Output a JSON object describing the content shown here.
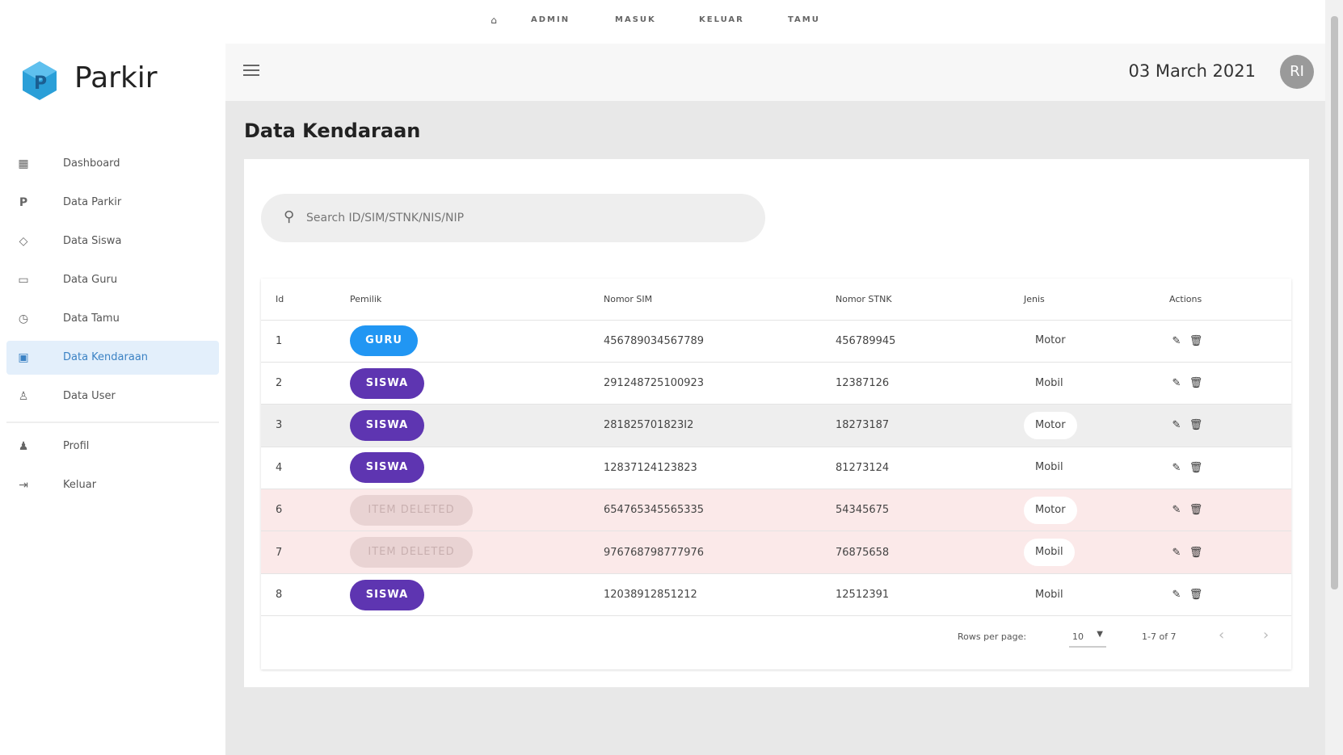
{
  "topnav": {
    "home_icon": "home-icon",
    "links": [
      "ADMIN",
      "MASUK",
      "KELUAR",
      "TAMU"
    ]
  },
  "sidebar": {
    "brand": "Parkir",
    "items": [
      {
        "label": "Dashboard",
        "icon": "dashboard-icon"
      },
      {
        "label": "Data Parkir",
        "icon": "parking-icon"
      },
      {
        "label": "Data Siswa",
        "icon": "graduation-cap-icon"
      },
      {
        "label": "Data Guru",
        "icon": "teacher-icon"
      },
      {
        "label": "Data Tamu",
        "icon": "clock-icon"
      },
      {
        "label": "Data Kendaraan",
        "icon": "car-icon",
        "active": true
      },
      {
        "label": "Data User",
        "icon": "user-settings-icon"
      },
      {
        "label": "Profil",
        "icon": "person-icon"
      },
      {
        "label": "Keluar",
        "icon": "logout-icon"
      }
    ]
  },
  "header": {
    "date": "03 March 2021",
    "avatar_initials": "RI"
  },
  "page": {
    "title": "Data Kendaraan",
    "search_placeholder": "Search ID/SIM/STNK/NIS/NIP"
  },
  "table": {
    "columns": [
      "Id",
      "Pemilik",
      "Nomor SIM",
      "Nomor STNK",
      "Jenis",
      "Actions"
    ],
    "rows": [
      {
        "id": "1",
        "pemilik": "GURU",
        "sim": "456789034567789",
        "stnk": "456789945",
        "jenis": "Motor"
      },
      {
        "id": "2",
        "pemilik": "SISWA",
        "sim": "291248725100923",
        "stnk": "12387126",
        "jenis": "Mobil"
      },
      {
        "id": "3",
        "pemilik": "SISWA",
        "sim": "281825701823I2",
        "stnk": "18273187",
        "jenis": "Motor"
      },
      {
        "id": "4",
        "pemilik": "SISWA",
        "sim": "12837124123823",
        "stnk": "81273124",
        "jenis": "Mobil"
      },
      {
        "id": "6",
        "pemilik": "ITEM DELETED",
        "sim": "654765345565335",
        "stnk": "54345675",
        "jenis": "Motor"
      },
      {
        "id": "7",
        "pemilik": "ITEM DELETED",
        "sim": "976768798777976",
        "stnk": "76875658",
        "jenis": "Mobil"
      },
      {
        "id": "8",
        "pemilik": "SISWA",
        "sim": "12038912851212",
        "stnk": "12512391",
        "jenis": "Mobil"
      }
    ],
    "edit_icon": "pencil-icon",
    "delete_icon": "trash-icon"
  },
  "pagination": {
    "rows_per_page_label": "Rows per page:",
    "rows_per_page_value": "10",
    "range": "1-7 of 7"
  },
  "colors": {
    "accent": "#2196f3",
    "siswa": "#5e35b1",
    "deleted_row": "#fbe9e9",
    "active_nav": "#e3effb"
  }
}
